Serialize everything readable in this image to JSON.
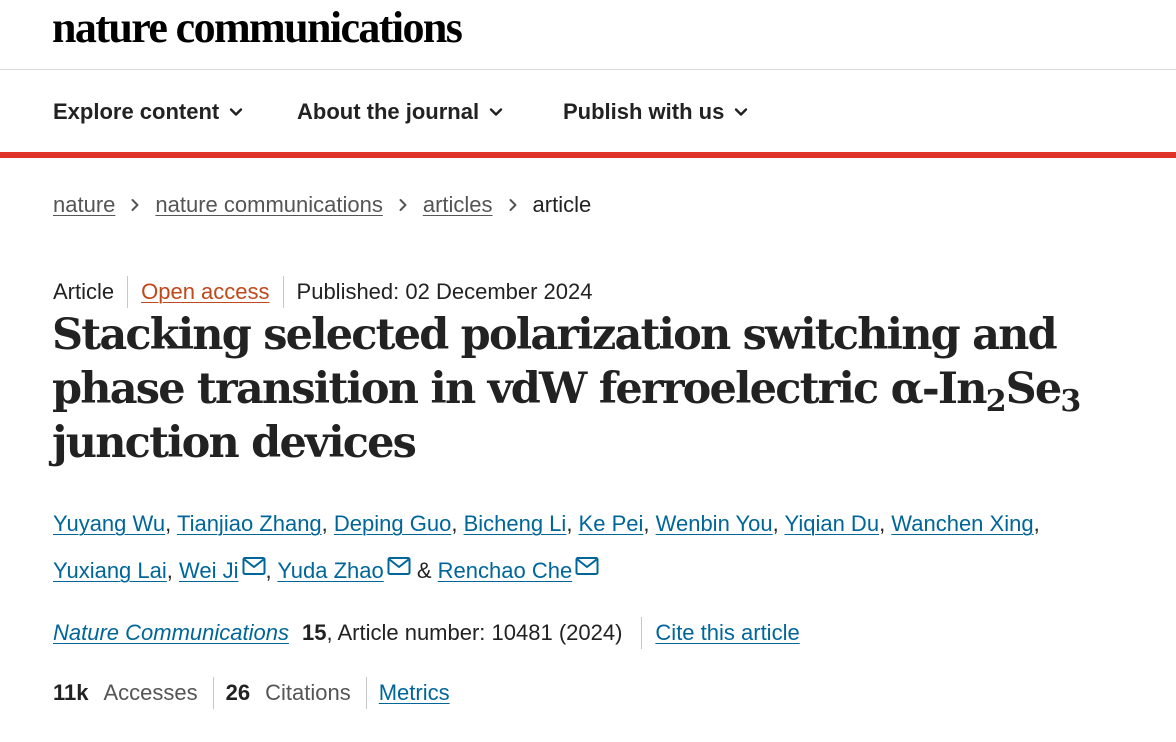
{
  "site": {
    "logo": "nature communications"
  },
  "nav": {
    "items": [
      {
        "label": "Explore content",
        "icon": "chevron-down-icon"
      },
      {
        "label": "About the journal",
        "icon": "chevron-down-icon"
      },
      {
        "label": "Publish with us",
        "icon": "chevron-down-icon"
      }
    ]
  },
  "colors": {
    "accent_rule": "#e0342a",
    "link": "#006699",
    "open_access": "#c0481b",
    "text": "#222222"
  },
  "breadcrumb": {
    "items": [
      "nature",
      "nature communications",
      "articles"
    ],
    "current": "article"
  },
  "article": {
    "type": "Article",
    "access": "Open access",
    "published": "Published: 02 December 2024",
    "title": {
      "part1": "Stacking selected polarization switching and phase transition in vdW ferroelectric α-In",
      "sub1": "2",
      "part2": "Se",
      "sub2": "3",
      "part3": "junction devices"
    },
    "authors": [
      "Yuyang Wu",
      "Tianjiao Zhang",
      "Deping Guo",
      "Bicheng Li",
      "Ke Pei",
      "Wenbin You",
      "Yiqian Du",
      "Wanchen Xing",
      "Yuxiang Lai",
      "Wei Ji",
      "Yuda Zhao",
      "Renchao Che"
    ],
    "author_separator": ", ",
    "author_last_separator": " & ",
    "journal": "Nature Communications",
    "volume": "15",
    "article_number_text": ", Article number: 10481 (2024)",
    "cite_label": "Cite this article"
  },
  "metrics": {
    "accesses_value": "11k",
    "accesses_label": "Accesses",
    "citations_value": "26",
    "citations_label": "Citations",
    "metrics_label": "Metrics"
  }
}
